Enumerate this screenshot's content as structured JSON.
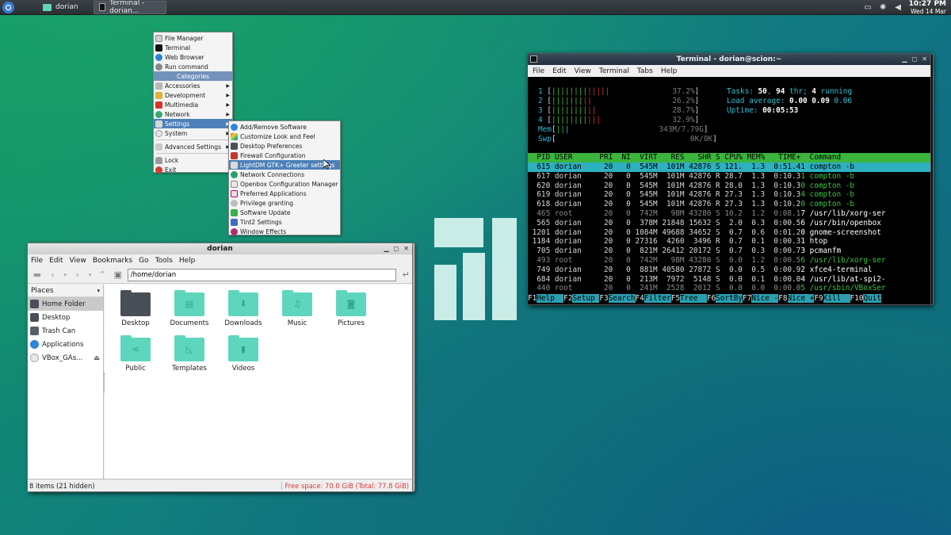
{
  "taskbar": {
    "tasks": [
      {
        "label": "dorian"
      },
      {
        "label": "Terminal - dorian..."
      }
    ],
    "clock": {
      "time": "10:27 PM",
      "date": "Wed 14 Mar"
    }
  },
  "menu_main": {
    "items_top": [
      "File Manager",
      "Terminal",
      "Web Browser",
      "Run command"
    ],
    "categories_header": "Categories",
    "categories": [
      "Accessories",
      "Development",
      "Multimedia",
      "Network",
      "Settings",
      "System"
    ],
    "items_bottom": [
      "Advanced Settings",
      "Lock",
      "Exit"
    ]
  },
  "menu_settings": {
    "items": [
      "Add/Remove Software",
      "Customize Look and Feel",
      "Desktop Preferences",
      "Firewall Configuration",
      "LightDM GTK+ Greeter settings",
      "Network Connections",
      "Openbox Configuration Manager",
      "Preferred Applications",
      "Privilege granting",
      "Software Update",
      "Tint2 Settings",
      "Window Effects"
    ]
  },
  "file_manager": {
    "title": "dorian",
    "menu": [
      "File",
      "Edit",
      "View",
      "Bookmarks",
      "Go",
      "Tools",
      "Help"
    ],
    "path": "/home/dorian",
    "places_label": "Places",
    "places": [
      "Home Folder",
      "Desktop",
      "Trash Can",
      "Applications",
      "VBox_GAs..."
    ],
    "items": [
      "Desktop",
      "Documents",
      "Downloads",
      "Music",
      "Pictures",
      "Public",
      "Templates",
      "Videos"
    ],
    "status_left": "8 items (21 hidden)",
    "status_right": "Free space: 70.0 GiB (Total: 77.8 GiB)"
  },
  "terminal": {
    "title": "Terminal - dorian@scion:~",
    "menu": [
      "File",
      "Edit",
      "View",
      "Terminal",
      "Tabs",
      "Help"
    ],
    "cpus": [
      {
        "n": "1",
        "pct": "37.2%"
      },
      {
        "n": "2",
        "pct": "26.2%"
      },
      {
        "n": "3",
        "pct": "28.7%"
      },
      {
        "n": "4",
        "pct": "32.9%"
      }
    ],
    "mem": "343M/7.79G",
    "swp": "0K/0K",
    "tasks_label": "Tasks: ",
    "tasks_val": "50",
    "thr_val": "94",
    "running_val": "4",
    "load_label": "Load average: ",
    "load_1": "0.00",
    "load_5": "0.09",
    "load_15": "0.06",
    "uptime_label": "Uptime: ",
    "uptime": "00:05:53",
    "header": "  PID USER      PRI  NI  VIRT   RES   SHR S CPU% MEM%   TIME+  Command",
    "procs": [
      "  615 dorian     20   0  545M  101M 42876 S 121.  1.3  0:51.41 compton -b",
      "  617 dorian     20   0  545M  101M 42876 R 28.7  1.3  0:10.31 compton -b",
      "  620 dorian     20   0  545M  101M 42876 R 28.0  1.3  0:10.30 compton -b",
      "  619 dorian     20   0  545M  101M 42876 R 27.3  1.3  0:10.34 compton -b",
      "  618 dorian     20   0  545M  101M 42876 R 27.3  1.3  0:10.20 compton -b",
      "  465 root       20   0  742M   98M 43280 S 10.2  1.2  0:08.17 /usr/lib/xorg-ser",
      "  565 dorian     20   0  378M 21848 15632 S  2.0  0.3  0:00.56 /usr/bin/openbox",
      " 1201 dorian     20   0 1084M 49688 34652 S  0.7  0.6  0:01.20 gnome-screenshot",
      " 1184 dorian     20   0 27316  4260  3496 R  0.7  0.1  0:00.31 htop",
      "  705 dorian     20   0  821M 26412 20172 S  0.7  0.3  0:00.73 pcmanfm",
      "  493 root       20   0  742M   98M 43280 S  0.0  1.2  0:00.56 /usr/lib/xorg-ser",
      "  749 dorian     20   0  881M 40580 27872 S  0.0  0.5  0:00.92 xfce4-terminal",
      "  684 dorian     20   0  213M  7972  5148 S  0.0  0.1  0:00.04 /usr/lib/at-spi2-",
      "  440 root       20   0  241M  2528  2012 S  0.0  0.0  0:00.05 /usr/sbin/VBoxSer"
    ],
    "fkeys": [
      {
        "k": "F1",
        "l": "Help  "
      },
      {
        "k": "F2",
        "l": "Setup "
      },
      {
        "k": "F3",
        "l": "Search"
      },
      {
        "k": "F4",
        "l": "Filter"
      },
      {
        "k": "F5",
        "l": "Tree  "
      },
      {
        "k": "F6",
        "l": "SortBy"
      },
      {
        "k": "F7",
        "l": "Nice -"
      },
      {
        "k": "F8",
        "l": "Nice +"
      },
      {
        "k": "F9",
        "l": "Kill  "
      },
      {
        "k": "F10",
        "l": "Quit"
      }
    ]
  },
  "colors": {
    "menu_highlight": "#4d80b8",
    "htop_header": "#3bb53b",
    "htop_selected": "#2db0c0",
    "folder_teal": "#5ed6bd",
    "logo": "#c9ece6"
  }
}
